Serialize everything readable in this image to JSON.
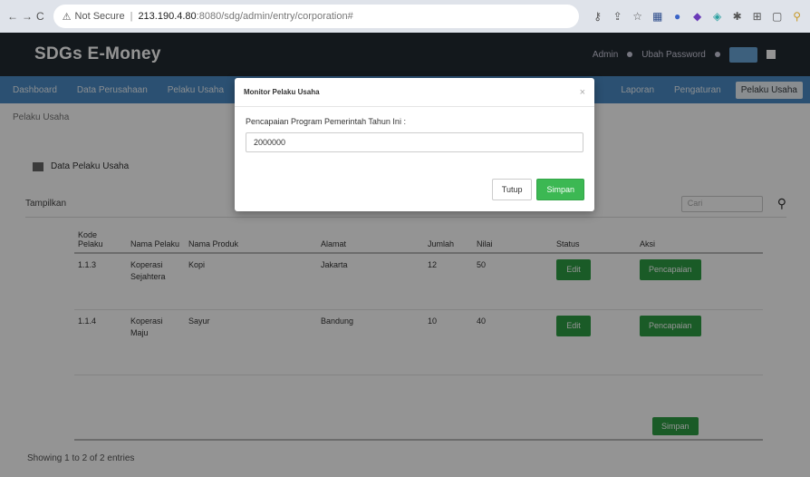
{
  "browser": {
    "nav": [
      "←",
      "→",
      "C"
    ],
    "security_icon": "warning-icon",
    "not_secure": "Not Secure",
    "separator": "|",
    "host": "213.190.4.80",
    "path": ":8080/sdg/admin/entry/corporation#",
    "extensions": [
      "key-icon",
      "share-icon",
      "star-icon",
      "grid-icon",
      "extension-icon",
      "puzzle-icon",
      "shield-icon",
      "pin-icon",
      "tab-icon",
      "window-icon",
      "profile-icon"
    ]
  },
  "app": {
    "brand": "SDGs E-Money",
    "nav_user": "Admin",
    "nav_item": "Ubah Password"
  },
  "menu": {
    "items": [
      "Dashboard",
      "Data Perusahaan",
      "Pelaku Usaha"
    ],
    "right_items": [
      "Laporan",
      "Pengaturan"
    ],
    "active": "Pelaku Usaha"
  },
  "page": {
    "breadcrumb": "Pelaku Usaha",
    "panel_title": "Data Pelaku Usaha",
    "filter_label": "Tampilkan",
    "search_placeholder": "Cari",
    "columns": [
      "Kode Pelaku",
      "Nama Pelaku",
      "Nama Produk",
      "Alamat",
      "Jumlah",
      "Nilai",
      "Status",
      "Aksi"
    ],
    "rows": [
      {
        "code": "1.1.3",
        "name": "Koperasi Sejahtera",
        "product": "Kopi",
        "address": "Jakarta",
        "qty": "12",
        "val": "50",
        "btn1": "Edit",
        "btn2": "Pencapaian"
      },
      {
        "code": "1.1.4",
        "name": "Koperasi Maju",
        "product": "Sayur",
        "address": "Bandung",
        "qty": "10",
        "val": "40",
        "btn1": "Edit",
        "btn2": "Pencapaian"
      }
    ],
    "total_button": "Simpan",
    "footer": "Showing 1 to 2 of 2 entries"
  },
  "modal": {
    "title": "Monitor Pelaku Usaha",
    "label": "Pencapaian Program Pemerintah Tahun Ini :",
    "value": "2000000",
    "cancel": "Tutup",
    "save": "Simpan"
  },
  "colors": {
    "navbar": "#222a31",
    "menubar": "#4b8bc4",
    "success": "#3cb853"
  }
}
